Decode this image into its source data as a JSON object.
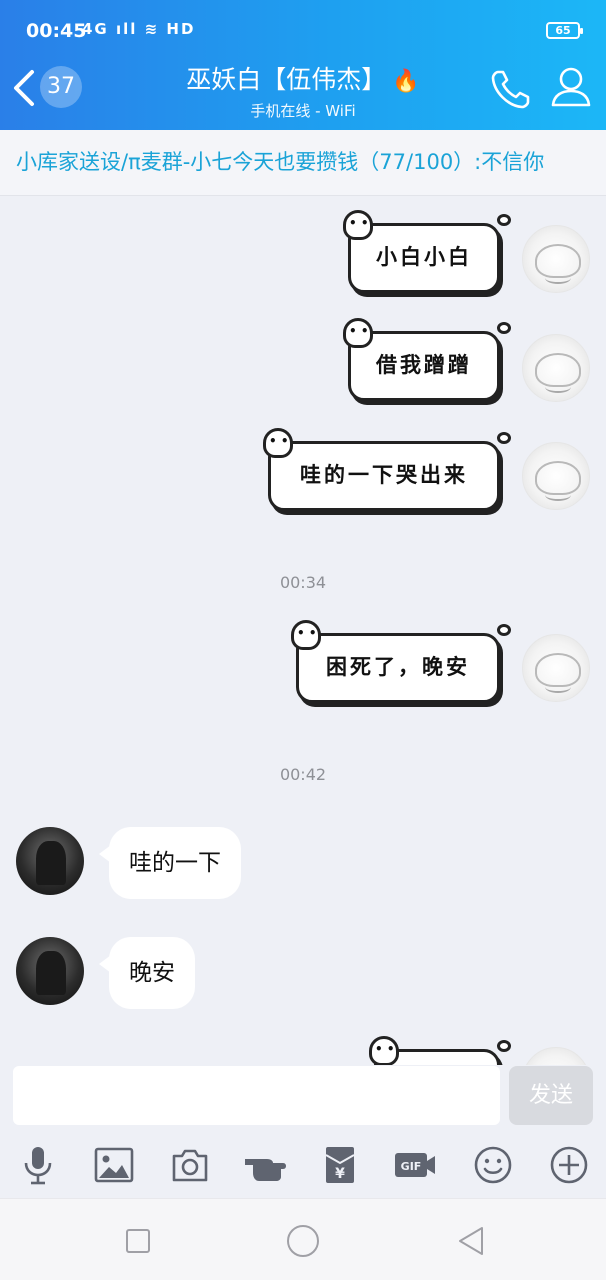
{
  "status_bar": {
    "time": "00:45",
    "signal": "4G ıll ≋ HD",
    "battery": "65"
  },
  "header": {
    "unread_count": "37",
    "title": "巫妖白【伍伟杰】",
    "subtitle": "手机在线 - WiFi"
  },
  "notice": {
    "text": "小库家送设/π麦群-小七今天也要攒钱（77/100）:不信你"
  },
  "messages": [
    {
      "from": "self",
      "type": "sticker",
      "text": "小白小白"
    },
    {
      "from": "self",
      "type": "sticker",
      "text": "借我蹭蹭"
    },
    {
      "from": "self",
      "type": "sticker",
      "text": "哇的一下哭出来"
    },
    {
      "type": "time",
      "text": "00:34"
    },
    {
      "from": "self",
      "type": "sticker",
      "text": "困死了，晚安"
    },
    {
      "type": "time",
      "text": "00:42"
    },
    {
      "from": "friend",
      "type": "text",
      "text": "哇的一下"
    },
    {
      "from": "friend",
      "type": "text",
      "text": "晚安"
    },
    {
      "from": "self",
      "type": "sticker",
      "text": ""
    }
  ],
  "input": {
    "value": "",
    "placeholder": "",
    "send_label": "发送"
  },
  "toolbar": {
    "icons": [
      "microphone-icon",
      "image-icon",
      "camera-icon",
      "pointing-hand-icon",
      "red-packet-icon",
      "gif-icon",
      "emoji-icon",
      "plus-icon"
    ]
  },
  "colors": {
    "header_start": "#2a7fe8",
    "header_end": "#1cb7f7",
    "notice_text": "#1aa3d7",
    "background": "#eef0f6"
  }
}
